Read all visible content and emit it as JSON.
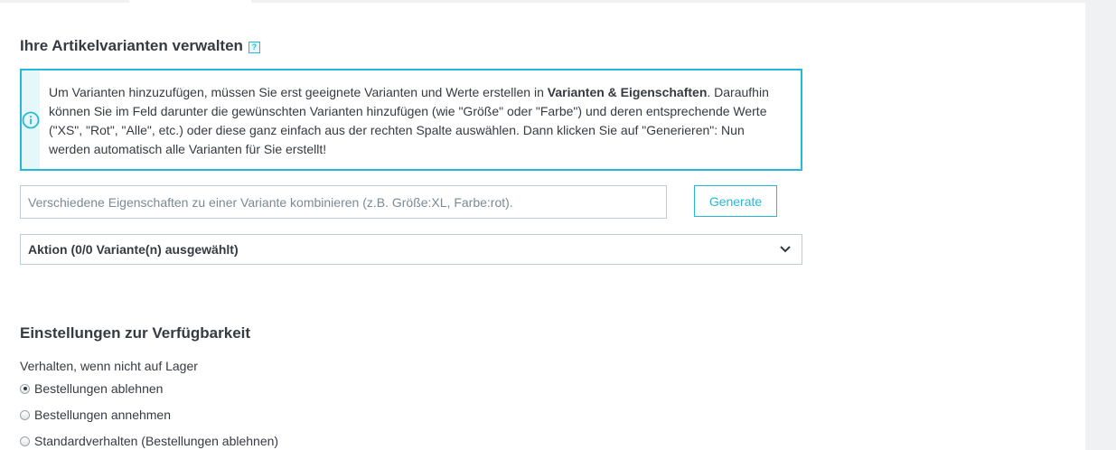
{
  "variants": {
    "title": "Ihre Artikelvarianten verwalten",
    "help_icon": "?",
    "info": {
      "icon": "info-circle-icon",
      "text_before": "Um Varianten hinzuzufügen, müssen Sie erst geeignete Varianten und Werte erstellen in ",
      "link_text": "Varianten & Eigenschaften",
      "text_after": ". Daraufhin können Sie im Feld darunter die gewünschten Varianten hinzufügen (wie \"Größe\" oder \"Farbe\") und deren entsprechende Werte (\"XS\", \"Rot\", \"Alle\", etc.) oder diese ganz einfach aus der rechten Spalte auswählen. Dann klicken Sie auf \"Generieren\": Nun werden automatisch alle Varianten für Sie erstellt!"
    },
    "combine_placeholder": "Verschiedene Eigenschaften zu einer Variante kombinieren (z.B. Größe:XL, Farbe:rot).",
    "combine_value": "",
    "generate_label": "Generate",
    "bulk_action_label": "Aktion (0/0 Variante(n) ausgewählt)",
    "bulk_action_icon": "chevron-down-icon"
  },
  "availability": {
    "title": "Einstellungen zur Verfügbarkeit",
    "out_of_stock_label": "Verhalten, wenn nicht auf Lager",
    "options": [
      {
        "label": "Bestellungen ablehnen",
        "checked": true
      },
      {
        "label": "Bestellungen annehmen",
        "checked": false
      },
      {
        "label": "Standardverhalten (Bestellungen ablehnen)",
        "checked": false
      }
    ]
  },
  "colors": {
    "accent": "#25b9d7",
    "text": "#363a41",
    "border": "#bbcdd2",
    "page_background": "#eff1f2"
  }
}
